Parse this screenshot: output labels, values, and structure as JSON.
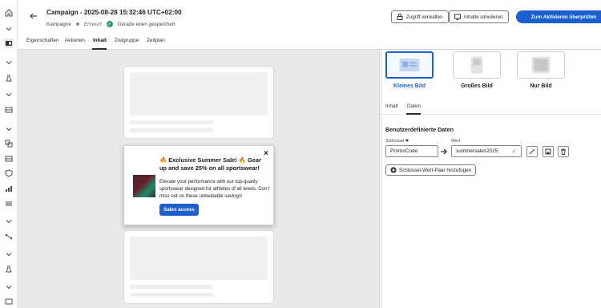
{
  "header": {
    "title": "Campaign - 2025-08-28 15:32:46 UTC+02:00",
    "type_label": "Kampagne",
    "status_label": "Entwurf",
    "saved_label": "Gerade eben gespeichert",
    "manage_access_label": "Zugriff verwalten",
    "simulate_content_label": "Inhalte simulieren",
    "review_activate_label": "Zum Aktivieren überprüfen"
  },
  "tabs": [
    {
      "label": "Eigenschaften"
    },
    {
      "label": "Aktionen"
    },
    {
      "label": "Inhalt",
      "active": true
    },
    {
      "label": "Zielgruppe"
    },
    {
      "label": "Zeitplan"
    }
  ],
  "popup": {
    "title": "🔥 Exclusive Summer Sale! 🔥 Gear up and save 25% on all sportswear!",
    "body": "Elevate your performance with our top-quality sportswear designed for athletes of all levels. Don't miss out on these unbeatable savings!",
    "button_label": "Sales access",
    "close_glyph": "×"
  },
  "layouts": [
    {
      "label": "Kleines Bild",
      "selected": true
    },
    {
      "label": "Großes Bild",
      "selected": false
    },
    {
      "label": "Nur Bild",
      "selected": false
    }
  ],
  "panel_tabs": [
    {
      "label": "Inhalt"
    },
    {
      "label": "Daten",
      "active": true
    }
  ],
  "custom_data": {
    "title": "Benutzerdefinierte Daten",
    "key_label": "Schlüssel ✱",
    "value_label": "Wert",
    "key_value": "PromoCode",
    "value_value": "summersales2025",
    "add_pair_label": "Schlüssel-Wert-Paar hinzufügen"
  },
  "colors": {
    "accent": "#1e5fd0",
    "success": "#2d9d78",
    "canvas": "#e9e9e9"
  },
  "icons": [
    "home-icon",
    "chevron-down-icon",
    "campaign-icon",
    "flask-icon",
    "table-icon",
    "copy-icon",
    "shield-icon",
    "chart-icon",
    "list-icon",
    "branch-icon",
    "arrow-left-icon",
    "lock-icon",
    "monitor-icon",
    "arrow-right-icon",
    "check-icon",
    "magic-wand-icon",
    "save-icon",
    "delete-icon",
    "plus-circle-icon"
  ]
}
